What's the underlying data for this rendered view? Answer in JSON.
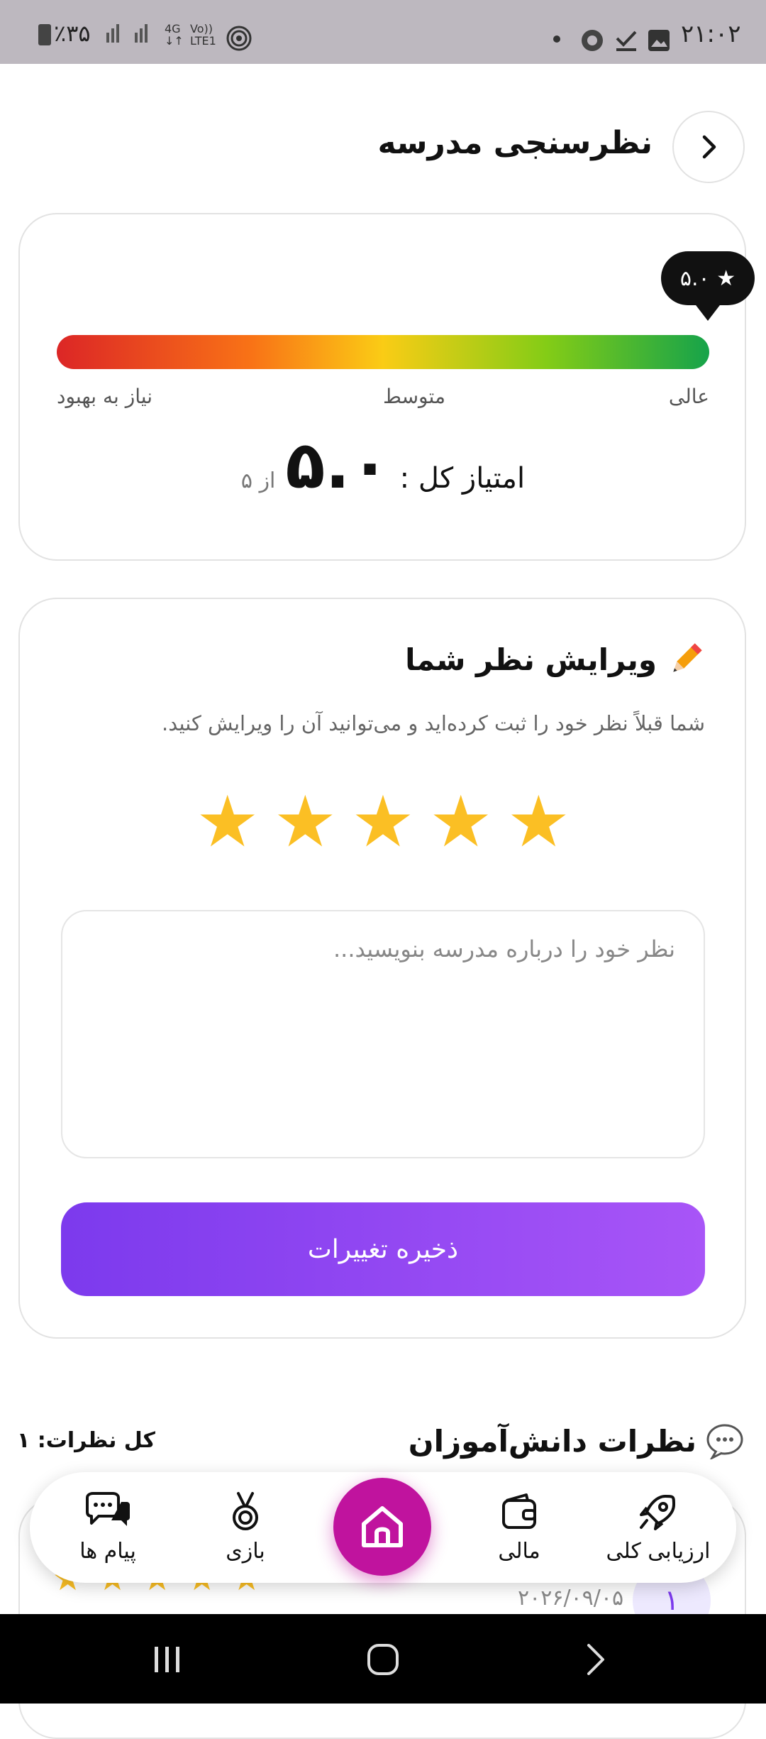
{
  "status_bar": {
    "time": "۲۱:۰۲",
    "battery": "٪۳۵",
    "network": "4G",
    "volte": "Vo))",
    "lte": "LTE1"
  },
  "header": {
    "title": "نظرسنجی مدرسه"
  },
  "rating_summary": {
    "tooltip": "★ ۵.۰",
    "label_excellent": "عالی",
    "label_average": "متوسط",
    "label_needs_improvement": "نیاز به بهبود",
    "total_label": "امتیاز کل :",
    "total_value": "۵.۰",
    "total_max": "از ۵"
  },
  "edit_section": {
    "icon": "pencil-icon",
    "title": "ویرایش نظر شما",
    "subtitle": "شما قبلاً نظر خود را ثبت کرده‌اید و می‌توانید آن را ویرایش کنید.",
    "stars": [
      "★",
      "★",
      "★",
      "★",
      "★"
    ],
    "rating": 5,
    "placeholder": "نظر خود را درباره مدرسه بنویسید...",
    "save_label": "ذخیره تغییرات"
  },
  "reviews_section": {
    "icon": "chat-bubble-icon",
    "title": "نظرات دانش‌آموزان",
    "total_count": "کل نظرات: ۱",
    "review": {
      "date": "۲۰۲۶/۰۹/۰۵",
      "avatar": "۱",
      "stars": [
        "★",
        "★",
        "★",
        "★",
        "★"
      ]
    }
  },
  "bottom_nav": {
    "items": [
      {
        "label": "ارزیابی کلی",
        "icon": "rocket-icon"
      },
      {
        "label": "مالی",
        "icon": "wallet-icon"
      },
      {
        "label": "",
        "icon": "home-icon"
      },
      {
        "label": "بازی",
        "icon": "medal-icon"
      },
      {
        "label": "پیام ها",
        "icon": "messages-icon"
      }
    ]
  },
  "colors": {
    "accent": "#8b5cf6",
    "home": "#c0139e",
    "star": "#fbbf24"
  }
}
